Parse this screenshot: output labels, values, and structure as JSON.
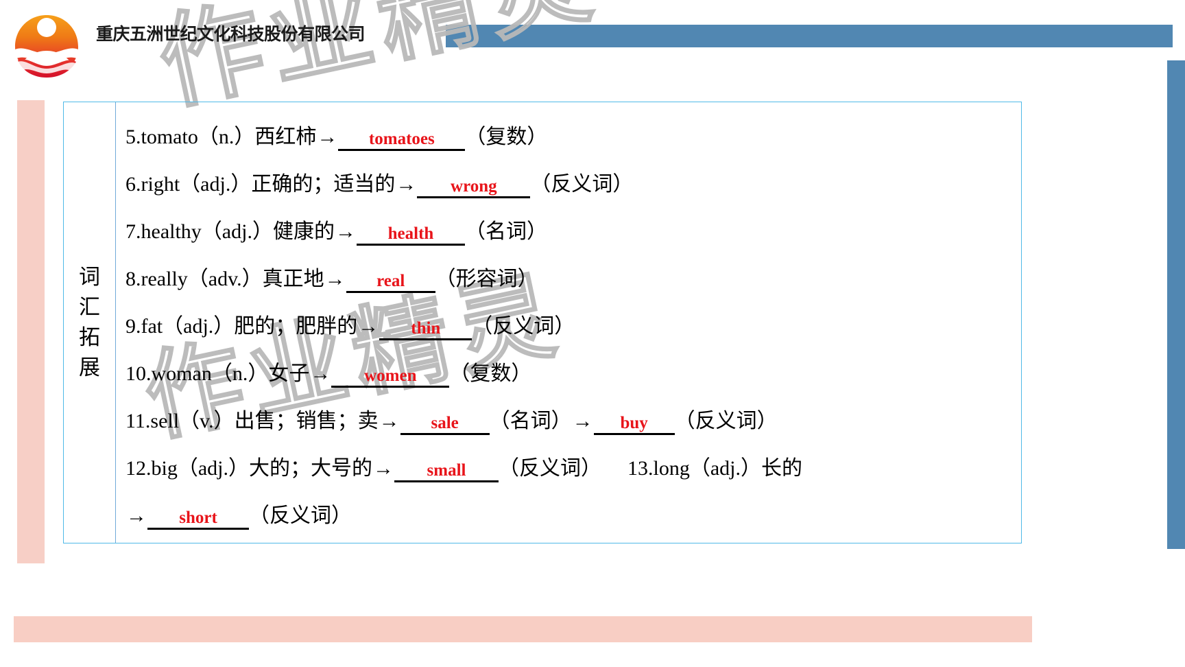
{
  "header": {
    "company_name": "重庆五洲世纪文化科技股份有限公司",
    "logo_icon": "sun-wave-circle-logo",
    "bar_color": "#5187b2",
    "pink_color": "#f8cec4"
  },
  "watermark": {
    "text": "作业精灵",
    "text2": "作业精灵"
  },
  "table": {
    "label": {
      "char1": "词",
      "char2": "汇",
      "char3": "拓",
      "char4": "展"
    },
    "border_color": "#4fb9e8",
    "answer_color": "#e8141a",
    "rows": [
      {
        "num": "5.",
        "word": "tomato",
        "pos": "（n.）",
        "meaning": " 西红柿",
        "arrow": "→",
        "answer": "tomatoes",
        "note": "（复数）"
      },
      {
        "num": "6.",
        "word": "right",
        "pos": "（adj.）",
        "meaning": " 正确的；适当的",
        "arrow": "→",
        "answer": "wrong",
        "note": "（反义词）"
      },
      {
        "num": "7.",
        "word": "healthy",
        "pos": "（adj.）",
        "meaning": " 健康的",
        "arrow": "→",
        "answer": "health",
        "note": "（名词）"
      },
      {
        "num": "8.",
        "word": "really",
        "pos": "（adv.）",
        "meaning": " 真正地",
        "arrow": "→",
        "answer": "real",
        "note": "（形容词）"
      },
      {
        "num": "9.",
        "word": "fat",
        "pos": "（adj.）",
        "meaning": " 肥的；肥胖的",
        "arrow": "→",
        "answer": "thin",
        "note": "（反义词）"
      },
      {
        "num": "10.",
        "word": "woman",
        "pos": "（n.）",
        "meaning": " 女子",
        "arrow": "→",
        "answer": "women",
        "note": "（复数）"
      },
      {
        "num": "11.",
        "word": "sell",
        "pos": "（v.）",
        "meaning": " 出售；销售；卖",
        "arrow": "→",
        "answer": "sale",
        "note": "（名词）",
        "arrow2": "→",
        "answer2": "buy",
        "note2": "（反义词）"
      },
      {
        "num": "12.",
        "word": "big",
        "pos": "（adj.）",
        "meaning": " 大的；大号的",
        "arrow": "→",
        "answer": "small",
        "note": "（反义词）",
        "num2": "13.",
        "word2": "long",
        "pos2": "（adj.）",
        "meaning2": " 长的"
      },
      {
        "arrow": "→",
        "answer": "short",
        "note": "（反义词）"
      }
    ]
  }
}
